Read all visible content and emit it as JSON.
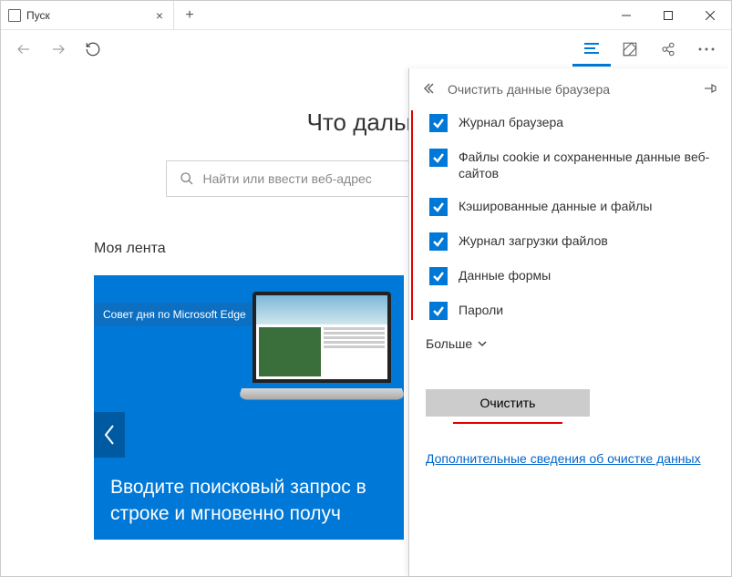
{
  "tab": {
    "title": "Пуск"
  },
  "content": {
    "headline": "Что дальш",
    "searchPlaceholder": "Найти или ввести веб-адрес",
    "feedTitle": "Моя лента",
    "tipBadge": "Совет дня по Microsoft Edge",
    "cardText": "Вводите поисковый запрос в строке и мгновенно получ"
  },
  "panel": {
    "title": "Очистить данные браузера",
    "items": [
      {
        "label": "Журнал браузера",
        "checked": true
      },
      {
        "label": "Файлы cookie и сохраненные данные веб-сайтов",
        "checked": true
      },
      {
        "label": "Кэшированные данные и файлы",
        "checked": true
      },
      {
        "label": "Журнал загрузки файлов",
        "checked": true
      },
      {
        "label": "Данные формы",
        "checked": true
      },
      {
        "label": "Пароли",
        "checked": true
      }
    ],
    "more": "Больше",
    "clearBtn": "Очистить",
    "learnMore": "Дополнительные сведения об очистке данных"
  }
}
